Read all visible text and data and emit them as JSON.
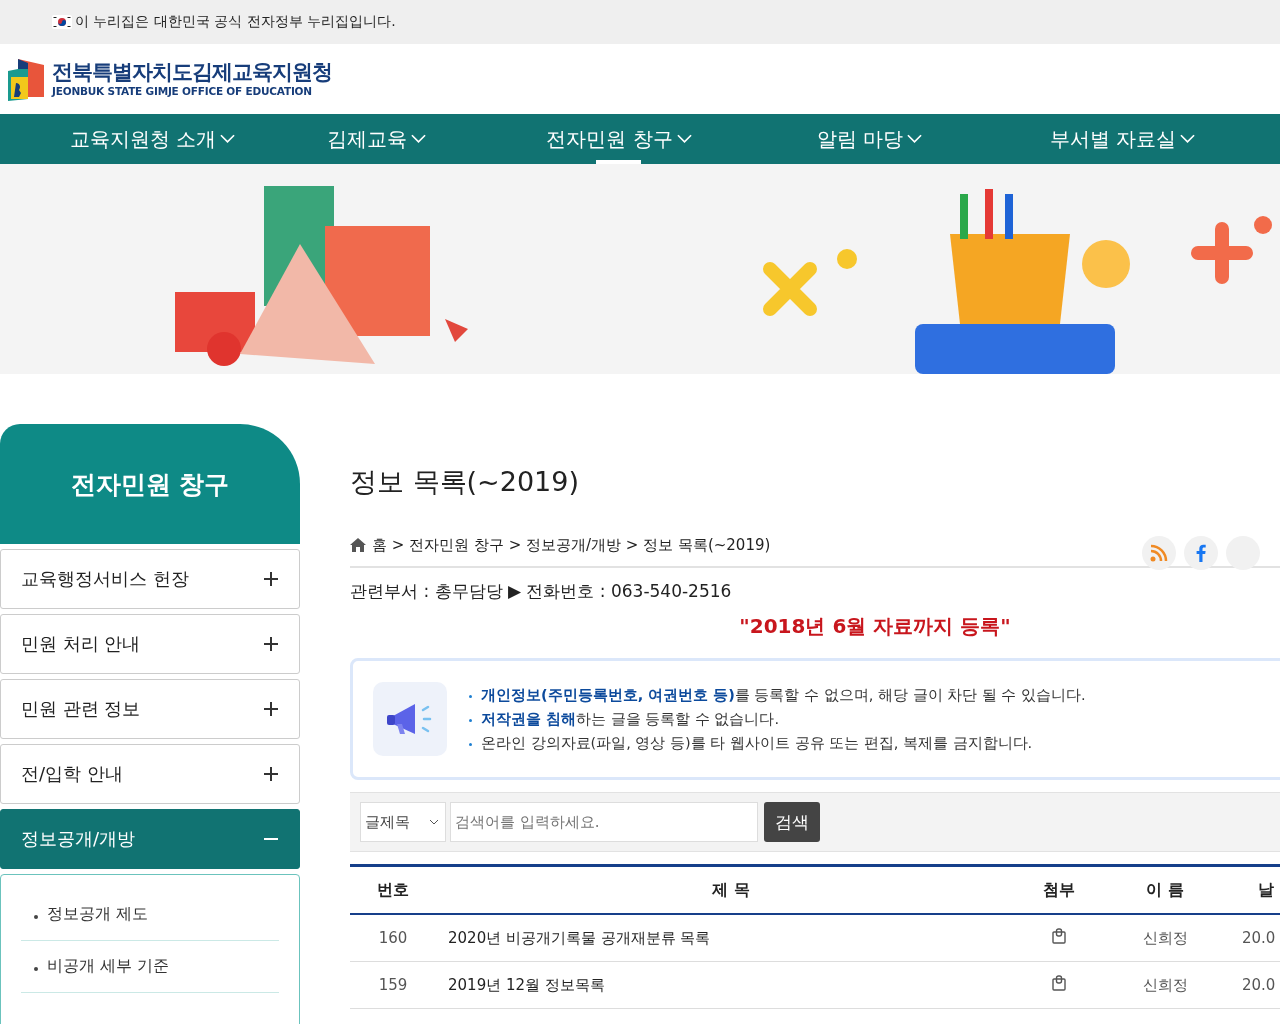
{
  "gov_banner": {
    "text": "이 누리집은 대한민국 공식 전자정부 누리집입니다."
  },
  "logo": {
    "title": "전북특별자치도김제교육지원청",
    "subtitle": "JEONBUK STATE GIMJE OFFICE OF EDUCATION"
  },
  "nav": [
    {
      "label": "교육지원청 소개",
      "selected": false
    },
    {
      "label": "김제교육",
      "selected": false
    },
    {
      "label": "전자민원 창구",
      "selected": true
    },
    {
      "label": "알림 마당",
      "selected": false
    },
    {
      "label": "부서별 자료실",
      "selected": false
    }
  ],
  "sidebar": {
    "title": "전자민원 창구",
    "items": [
      {
        "label": "교육행정서비스 헌장",
        "expanded": false
      },
      {
        "label": "민원 처리 안내",
        "expanded": false
      },
      {
        "label": "민원 관련 정보",
        "expanded": false
      },
      {
        "label": "전/입학 안내",
        "expanded": false
      },
      {
        "label": "정보공개/개방",
        "expanded": true,
        "children": [
          {
            "label": "정보공개 제도"
          },
          {
            "label": "비공개 세부 기준"
          }
        ]
      }
    ]
  },
  "content": {
    "title": "정보 목록(~2019)",
    "breadcrumb": "홈 > 전자민원 창구 > 정보공개/개방 > 정보 목록(~2019)",
    "department": "관련부서 : 총무담당 ▶ 전화번호 : 063-540-2516",
    "notice": "\"2018년 6월 자료까지 등록\"",
    "rules": [
      "**개인정보(주민등록번호, 여권번호 등)**를 등록할 수 없으며, 해당 글이 차단 될 수 있습니다.",
      "**저작권을 침해**하는 글을 등록할 수 없습니다.",
      "온라인 강의자료(파일, 영상 등)를 타 웹사이트 공유 또는 편집, 복제를 금지합니다."
    ],
    "search": {
      "category": "글제목",
      "placeholder": "검색어를 입력하세요.",
      "button": "검색"
    },
    "table": {
      "columns": [
        "번호",
        "제 목",
        "첨부",
        "이 름",
        "날"
      ],
      "rows": [
        {
          "number": "160",
          "title": "2020년 비공개기록물 공개재분류 목록",
          "attachment": true,
          "name": "신희정",
          "date": "20.0"
        },
        {
          "number": "159",
          "title": "2019년 12월 정보목록",
          "attachment": true,
          "name": "신희정",
          "date": "20.0"
        }
      ]
    }
  }
}
